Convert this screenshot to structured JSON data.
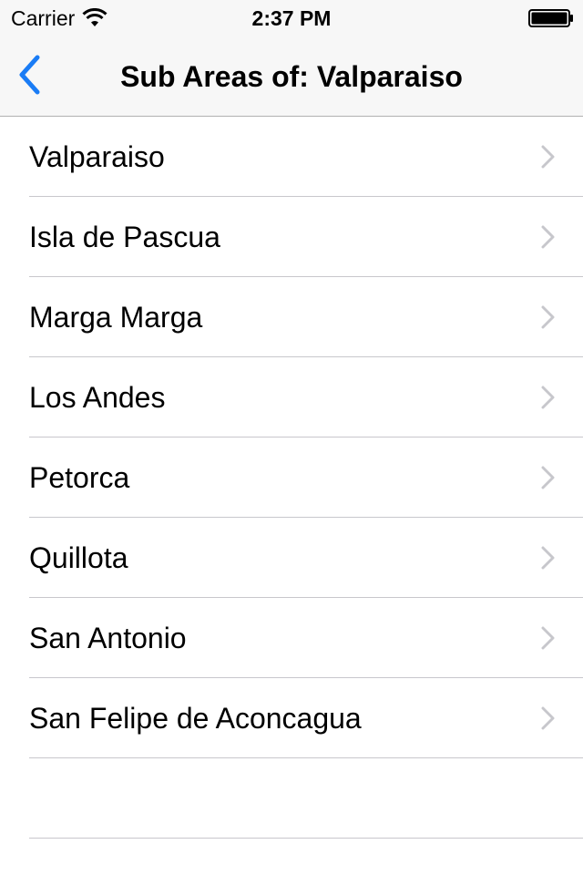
{
  "status_bar": {
    "carrier": "Carrier",
    "time": "2:37 PM",
    "icons": [
      "wifi-icon",
      "battery-icon"
    ]
  },
  "nav_bar": {
    "back_icon": "chevron-left-icon",
    "title": "Sub Areas of: Valparaiso",
    "accent_color": "#1a7cf5"
  },
  "list": {
    "items": [
      {
        "label": "Valparaiso",
        "icon": "chevron-right-icon"
      },
      {
        "label": "Isla de Pascua",
        "icon": "chevron-right-icon"
      },
      {
        "label": "Marga Marga",
        "icon": "chevron-right-icon"
      },
      {
        "label": "Los Andes",
        "icon": "chevron-right-icon"
      },
      {
        "label": "Petorca",
        "icon": "chevron-right-icon"
      },
      {
        "label": "Quillota",
        "icon": "chevron-right-icon"
      },
      {
        "label": "San Antonio",
        "icon": "chevron-right-icon"
      },
      {
        "label": "San Felipe de Aconcagua",
        "icon": "chevron-right-icon"
      }
    ]
  }
}
